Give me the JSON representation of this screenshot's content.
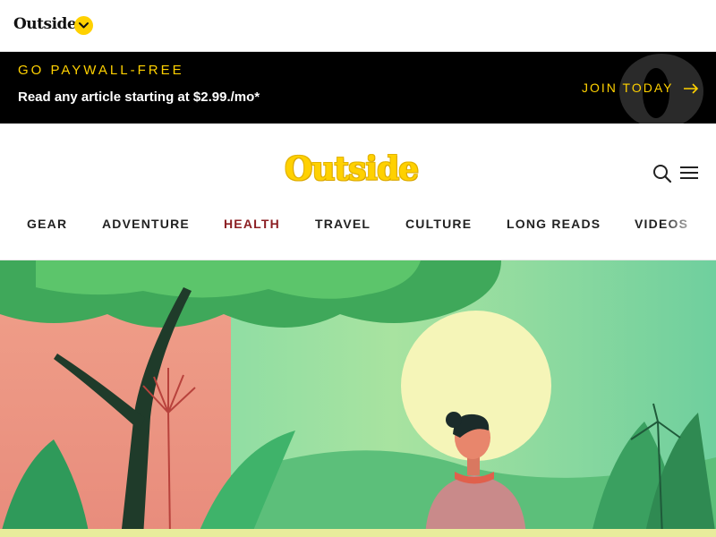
{
  "topbar": {
    "brand": "Outside",
    "dropdown_icon": "chevron-down-icon"
  },
  "promo": {
    "headline": "GO PAYWALL-FREE",
    "subtext": "Read any article starting at $2.99./mo*",
    "cta_label": "JOIN TODAY",
    "cta_icon": "arrow-right-icon",
    "accent_color": "#ffd100"
  },
  "masthead": {
    "logo": "Outside",
    "logo_color": "#ffd100",
    "search_icon": "search-icon",
    "menu_icon": "hamburger-menu-icon"
  },
  "nav": {
    "items": [
      {
        "label": "GEAR"
      },
      {
        "label": "ADVENTURE"
      },
      {
        "label": "HEALTH",
        "active": true
      },
      {
        "label": "TRAVEL"
      },
      {
        "label": "CULTURE"
      },
      {
        "label": "LONG READS"
      },
      {
        "label": "VIDEOS"
      }
    ],
    "active_color": "#8c1f23"
  },
  "hero": {
    "description_icon": "illustration-woman-sunset-plants"
  }
}
